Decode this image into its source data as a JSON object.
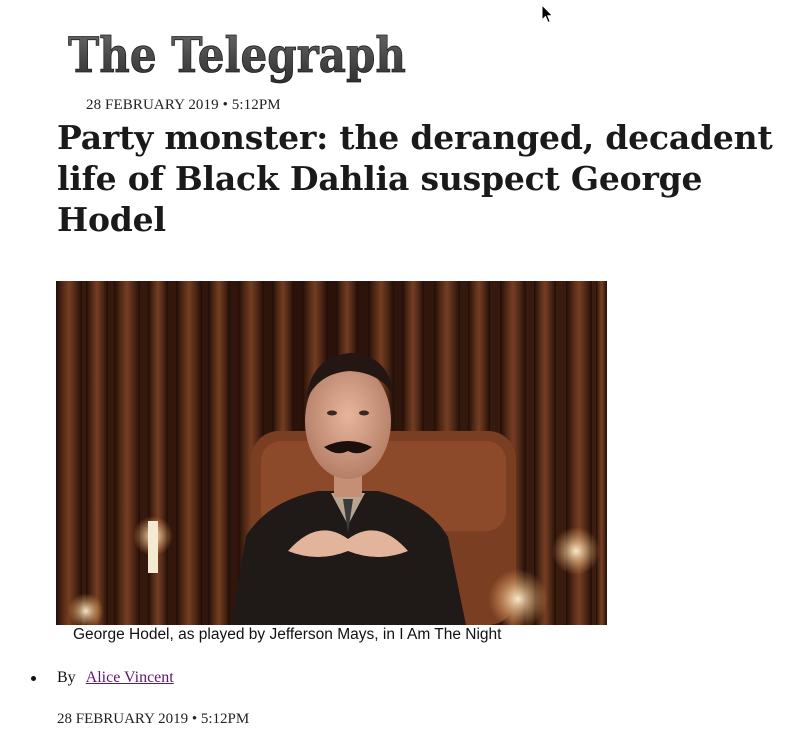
{
  "masthead": {
    "logo_text": "The Telegraph"
  },
  "article": {
    "dateline_top": "28 FEBRUARY 2019 • 5:12PM",
    "headline": "Party monster: the deranged, decadent life of Black Dahlia suspect George Hodel",
    "image_caption": "George Hodel, as played by Jefferson Mays, in I Am The Night",
    "byline_prefix": "By",
    "author": "Alice Vincent",
    "dateline_bottom": "28 FEBRUARY 2019 • 5:12PM"
  },
  "colors": {
    "link": "#5a1a6e",
    "text": "#1a1a1a"
  },
  "icons": {
    "cursor": "mouse-pointer-icon",
    "bullet": "bullet-dot"
  }
}
